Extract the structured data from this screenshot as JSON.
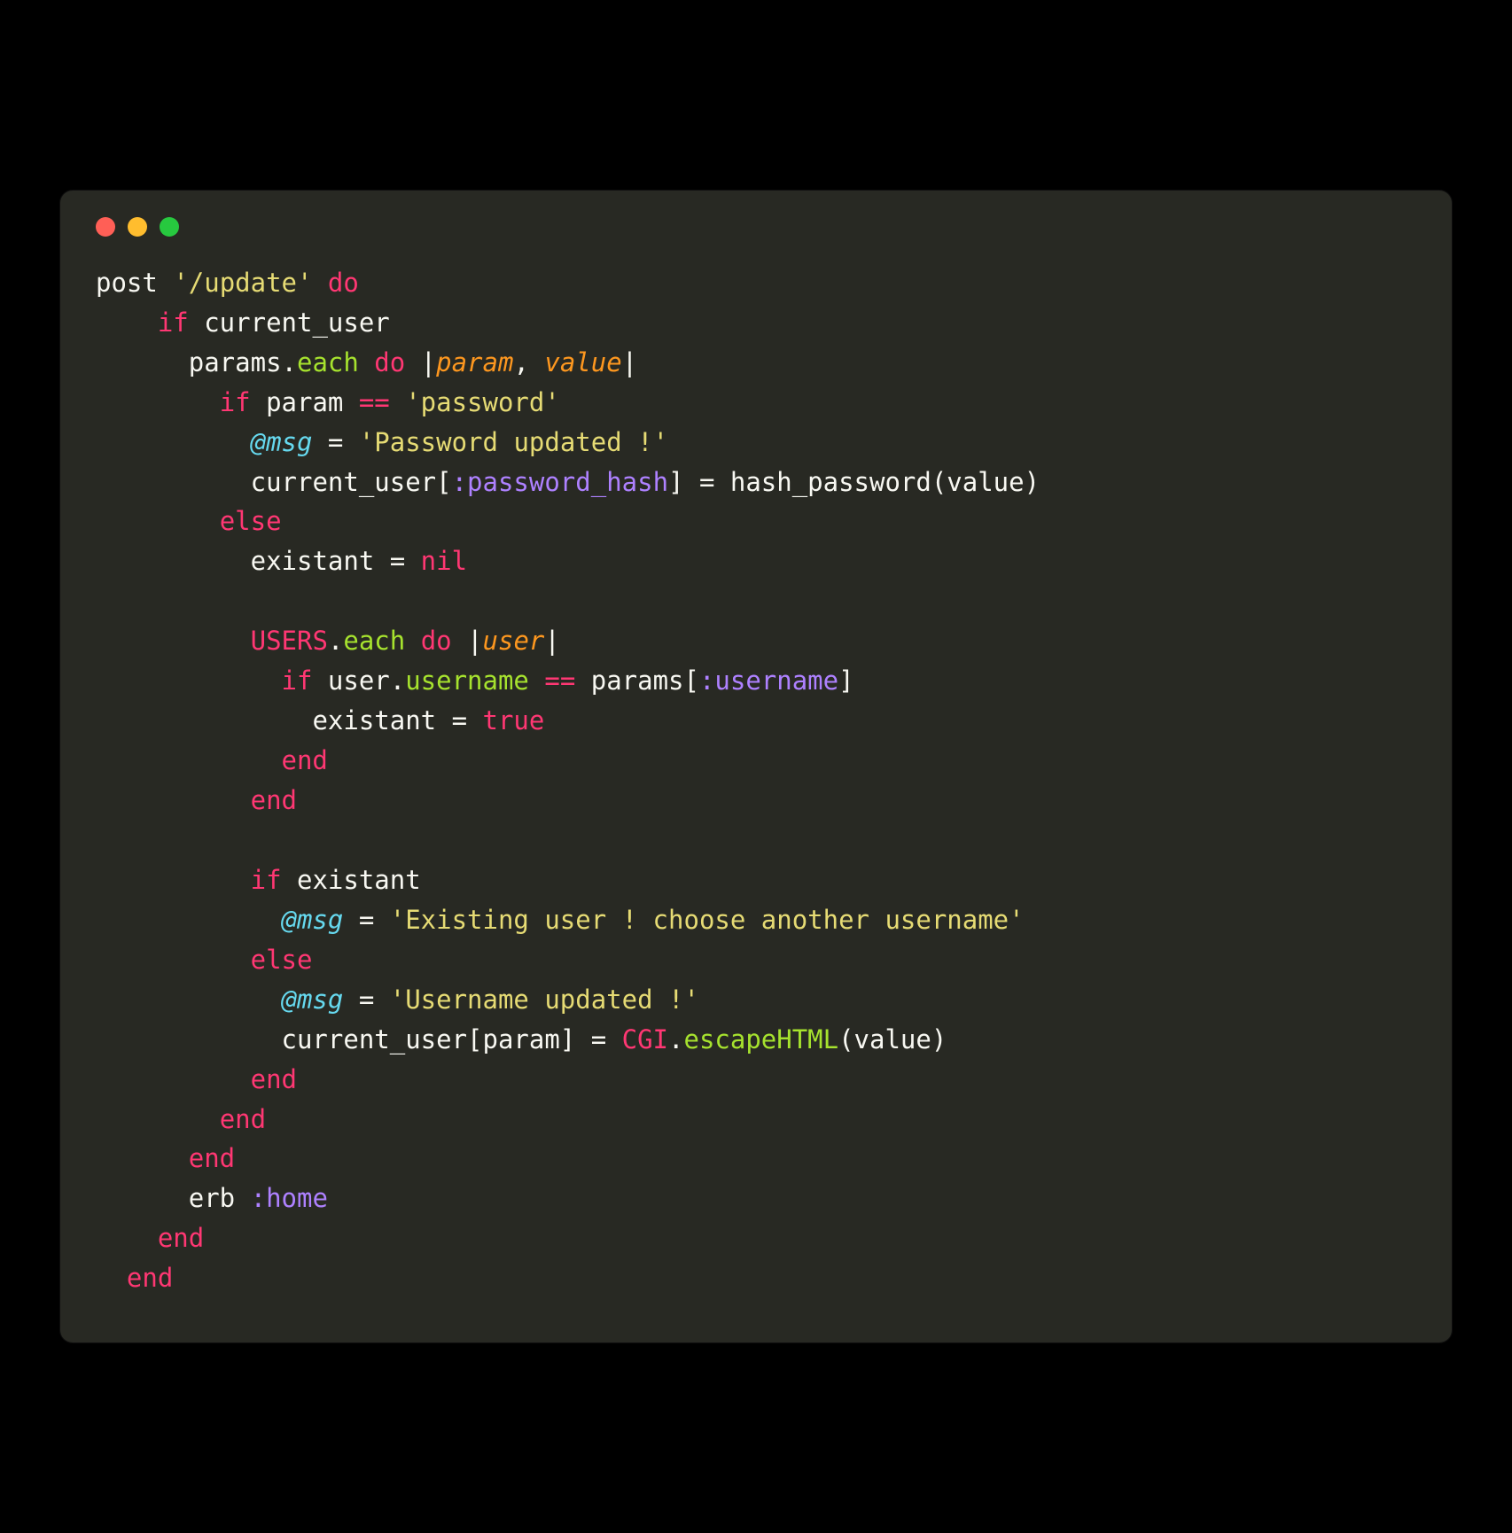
{
  "window": {
    "traffic_lights": [
      "red",
      "yellow",
      "green"
    ]
  },
  "code": {
    "language": "ruby",
    "lines": [
      {
        "indent": 0,
        "tokens": [
          {
            "t": "post ",
            "c": "c-plain"
          },
          {
            "t": "'/update'",
            "c": "c-string"
          },
          {
            "t": " ",
            "c": "c-plain"
          },
          {
            "t": "do",
            "c": "c-keyword"
          }
        ]
      },
      {
        "indent": 4,
        "tokens": [
          {
            "t": "if",
            "c": "c-keyword"
          },
          {
            "t": " current_user",
            "c": "c-plain"
          }
        ]
      },
      {
        "indent": 6,
        "tokens": [
          {
            "t": "params.",
            "c": "c-plain"
          },
          {
            "t": "each",
            "c": "c-method"
          },
          {
            "t": " ",
            "c": "c-plain"
          },
          {
            "t": "do",
            "c": "c-keyword"
          },
          {
            "t": " |",
            "c": "c-plain"
          },
          {
            "t": "param",
            "c": "c-param"
          },
          {
            "t": ", ",
            "c": "c-plain"
          },
          {
            "t": "value",
            "c": "c-param"
          },
          {
            "t": "|",
            "c": "c-plain"
          }
        ]
      },
      {
        "indent": 8,
        "tokens": [
          {
            "t": "if",
            "c": "c-keyword"
          },
          {
            "t": " param ",
            "c": "c-plain"
          },
          {
            "t": "==",
            "c": "c-op"
          },
          {
            "t": " ",
            "c": "c-plain"
          },
          {
            "t": "'password'",
            "c": "c-string"
          }
        ]
      },
      {
        "indent": 10,
        "tokens": [
          {
            "t": "@msg",
            "c": "c-ivar"
          },
          {
            "t": " = ",
            "c": "c-plain"
          },
          {
            "t": "'Password updated !'",
            "c": "c-string"
          }
        ]
      },
      {
        "indent": 10,
        "tokens": [
          {
            "t": "current_user[",
            "c": "c-plain"
          },
          {
            "t": ":password_hash",
            "c": "c-sym"
          },
          {
            "t": "] = hash_password(value)",
            "c": "c-plain"
          }
        ]
      },
      {
        "indent": 8,
        "tokens": [
          {
            "t": "else",
            "c": "c-keyword"
          }
        ]
      },
      {
        "indent": 10,
        "tokens": [
          {
            "t": "existant = ",
            "c": "c-plain"
          },
          {
            "t": "nil",
            "c": "c-keyword"
          }
        ]
      },
      {
        "indent": 0,
        "tokens": [
          {
            "t": " ",
            "c": "c-plain"
          }
        ]
      },
      {
        "indent": 10,
        "tokens": [
          {
            "t": "USERS",
            "c": "c-const"
          },
          {
            "t": ".",
            "c": "c-plain"
          },
          {
            "t": "each",
            "c": "c-method"
          },
          {
            "t": " ",
            "c": "c-plain"
          },
          {
            "t": "do",
            "c": "c-keyword"
          },
          {
            "t": " |",
            "c": "c-plain"
          },
          {
            "t": "user",
            "c": "c-param"
          },
          {
            "t": "|",
            "c": "c-plain"
          }
        ]
      },
      {
        "indent": 12,
        "tokens": [
          {
            "t": "if",
            "c": "c-keyword"
          },
          {
            "t": " user.",
            "c": "c-plain"
          },
          {
            "t": "username",
            "c": "c-method"
          },
          {
            "t": " ",
            "c": "c-plain"
          },
          {
            "t": "==",
            "c": "c-op"
          },
          {
            "t": " params[",
            "c": "c-plain"
          },
          {
            "t": ":username",
            "c": "c-sym"
          },
          {
            "t": "]",
            "c": "c-plain"
          }
        ]
      },
      {
        "indent": 14,
        "tokens": [
          {
            "t": "existant = ",
            "c": "c-plain"
          },
          {
            "t": "true",
            "c": "c-keyword"
          }
        ]
      },
      {
        "indent": 12,
        "tokens": [
          {
            "t": "end",
            "c": "c-keyword"
          }
        ]
      },
      {
        "indent": 10,
        "tokens": [
          {
            "t": "end",
            "c": "c-keyword"
          }
        ]
      },
      {
        "indent": 0,
        "tokens": [
          {
            "t": " ",
            "c": "c-plain"
          }
        ]
      },
      {
        "indent": 10,
        "tokens": [
          {
            "t": "if",
            "c": "c-keyword"
          },
          {
            "t": " existant",
            "c": "c-plain"
          }
        ]
      },
      {
        "indent": 12,
        "tokens": [
          {
            "t": "@msg",
            "c": "c-ivar"
          },
          {
            "t": " = ",
            "c": "c-plain"
          },
          {
            "t": "'Existing user ! choose another username'",
            "c": "c-string"
          }
        ]
      },
      {
        "indent": 10,
        "tokens": [
          {
            "t": "else",
            "c": "c-keyword"
          }
        ]
      },
      {
        "indent": 12,
        "tokens": [
          {
            "t": "@msg",
            "c": "c-ivar"
          },
          {
            "t": " = ",
            "c": "c-plain"
          },
          {
            "t": "'Username updated !'",
            "c": "c-string"
          }
        ]
      },
      {
        "indent": 12,
        "tokens": [
          {
            "t": "current_user[param] = ",
            "c": "c-plain"
          },
          {
            "t": "CGI",
            "c": "c-const"
          },
          {
            "t": ".",
            "c": "c-plain"
          },
          {
            "t": "escapeHTML",
            "c": "c-method"
          },
          {
            "t": "(value)",
            "c": "c-plain"
          }
        ]
      },
      {
        "indent": 10,
        "tokens": [
          {
            "t": "end",
            "c": "c-keyword"
          }
        ]
      },
      {
        "indent": 8,
        "tokens": [
          {
            "t": "end",
            "c": "c-keyword"
          }
        ]
      },
      {
        "indent": 6,
        "tokens": [
          {
            "t": "end",
            "c": "c-keyword"
          }
        ]
      },
      {
        "indent": 6,
        "tokens": [
          {
            "t": "erb ",
            "c": "c-plain"
          },
          {
            "t": ":home",
            "c": "c-sym"
          }
        ]
      },
      {
        "indent": 4,
        "tokens": [
          {
            "t": "end",
            "c": "c-keyword"
          }
        ]
      },
      {
        "indent": 2,
        "tokens": [
          {
            "t": "end",
            "c": "c-keyword"
          }
        ]
      }
    ]
  }
}
